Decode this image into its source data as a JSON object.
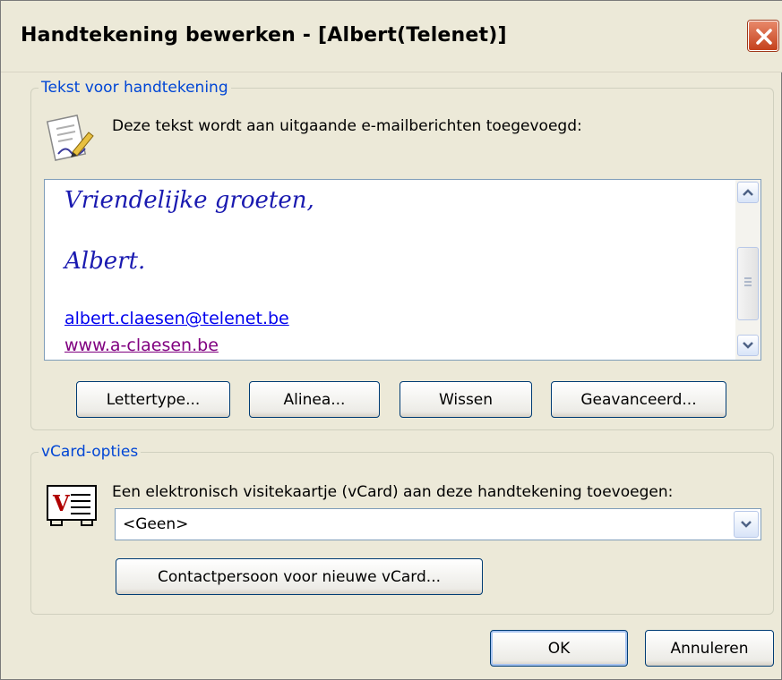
{
  "window": {
    "title": "Handtekening bewerken - [Albert(Telenet)]",
    "close_icon": "close-icon"
  },
  "signature_group": {
    "legend": "Tekst voor handtekening",
    "icon": "signature-edit-icon",
    "description": "Deze tekst wordt aan uitgaande e-mailberichten toegevoegd:",
    "lines": {
      "greeting": "Vriendelijke groeten,",
      "name": "Albert.",
      "email": "albert.claesen@telenet.be",
      "website": "www.a-claesen.be"
    },
    "scroll_position": 0.45,
    "buttons": {
      "font": "Lettertype...",
      "paragraph": "Alinea...",
      "clear": "Wissen",
      "advanced": "Geavanceerd..."
    }
  },
  "vcard_group": {
    "legend": "vCard-opties",
    "icon": "vcard-icon",
    "description": "Een elektronisch visitekaartje (vCard) aan deze handtekening toevoegen:",
    "select_value": "<Geen>",
    "new_contact_button": "Contactpersoon voor nieuwe vCard..."
  },
  "footer": {
    "ok": "OK",
    "cancel": "Annuleren"
  },
  "colors": {
    "accent": "#0046d5",
    "dialog_bg": "#ece9d8",
    "close_red": "#c4411c",
    "script_text": "#1a1ab0",
    "link": "#0000ee",
    "visited_link": "#800080"
  }
}
